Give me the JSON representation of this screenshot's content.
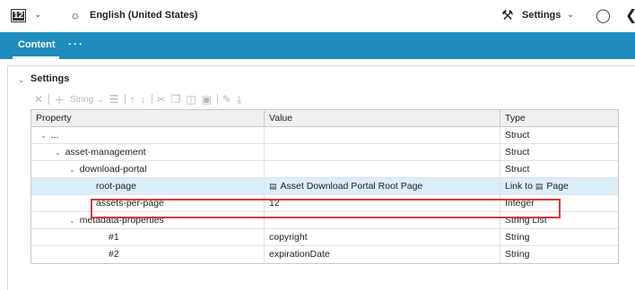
{
  "topbar": {
    "badge_number": "12",
    "language_label": "English (United States)",
    "settings_label": "Settings"
  },
  "tabs": {
    "active_label": "Content",
    "more_label": "···"
  },
  "section": {
    "title": "Settings"
  },
  "toolbar": {
    "type_label": "String"
  },
  "table": {
    "headers": {
      "property": "Property",
      "value": "Value",
      "type": "Type"
    },
    "rows": [
      {
        "property": "...",
        "value": "",
        "type": "Struct"
      },
      {
        "property": "asset-management",
        "value": "",
        "type": "Struct"
      },
      {
        "property": "download-portal",
        "value": "",
        "type": "Struct"
      },
      {
        "property": "root-page",
        "value": "Asset Download Portal Root Page",
        "type": "Link to",
        "type_suffix": "Page"
      },
      {
        "property": "assets-per-page",
        "value": "12",
        "type": "Integer"
      },
      {
        "property": "metadata-properties",
        "value": "",
        "type": "String List"
      },
      {
        "property": "#1",
        "value": "copyright",
        "type": "String"
      },
      {
        "property": "#2",
        "value": "expirationDate",
        "type": "String"
      }
    ]
  },
  "colors": {
    "tab_bar": "#1f8dbd",
    "selected_row": "#dceefa",
    "highlight_border": "#d9373f"
  }
}
